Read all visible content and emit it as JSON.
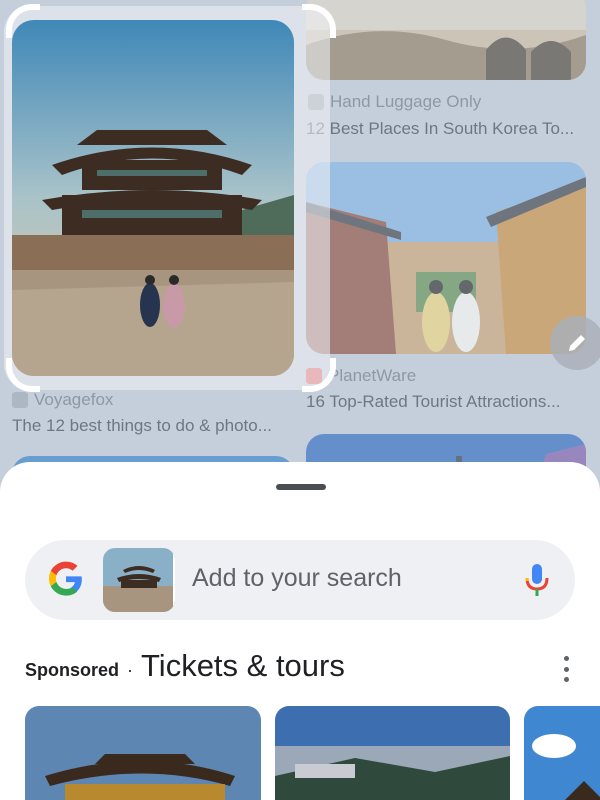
{
  "results": {
    "right_top": {
      "source": "Hand Luggage Only",
      "title": "12 Best Places In South Korea To..."
    },
    "left_main": {
      "source": "Voyagefox",
      "title": "The 12 best things to do & photo..."
    },
    "right_middle": {
      "source": "PlanetWare",
      "title": "16 Top-Rated Tourist Attractions..."
    }
  },
  "search": {
    "placeholder": "Add to your search"
  },
  "sponsored_section": {
    "sponsored_label": "Sponsored",
    "separator": "·",
    "title": "Tickets & tours"
  },
  "icons": {
    "google": "google-g-icon",
    "mic": "microphone-icon",
    "menu": "more-vert-icon",
    "edit": "pencil-icon"
  },
  "colors": {
    "sheet_bg": "#ffffff",
    "search_bg": "#eef0f3",
    "text_primary": "#202124",
    "text_secondary": "#5f6368"
  }
}
